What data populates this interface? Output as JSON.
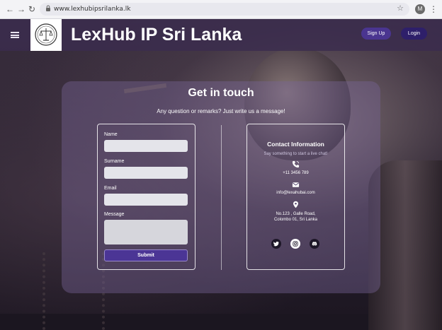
{
  "browser": {
    "url": "www.lexhubipsrilanka.lk",
    "avatar_letter": "M"
  },
  "header": {
    "brand": "LexHub IP Sri Lanka",
    "signup_label": "Sign Up",
    "login_label": "Login"
  },
  "contact_card": {
    "title": "Get in touch",
    "subtitle": "Any question or remarks? Just write us a message!"
  },
  "form": {
    "name_label": "Name",
    "surname_label": "Surname",
    "email_label": "Email",
    "message_label": "Message",
    "name_value": "",
    "surname_value": "",
    "email_value": "",
    "message_value": "",
    "submit_label": "Submit"
  },
  "contact_info": {
    "title": "Contact Information",
    "subtitle": "Say something to start a live chat!",
    "phone": "+11 3456 789",
    "email": "info@lexahubai.com",
    "address_line1": "No.123 , Galle Road,",
    "address_line2": "Colombo 01, Sri Lanka",
    "social_icons": [
      "twitter-icon",
      "instagram-icon",
      "discord-icon"
    ]
  },
  "colors": {
    "header_bg": "#3a2c4e",
    "button_primary": "#4b3595",
    "button_dark": "#2e1f6a",
    "card_overlay": "#786496"
  }
}
